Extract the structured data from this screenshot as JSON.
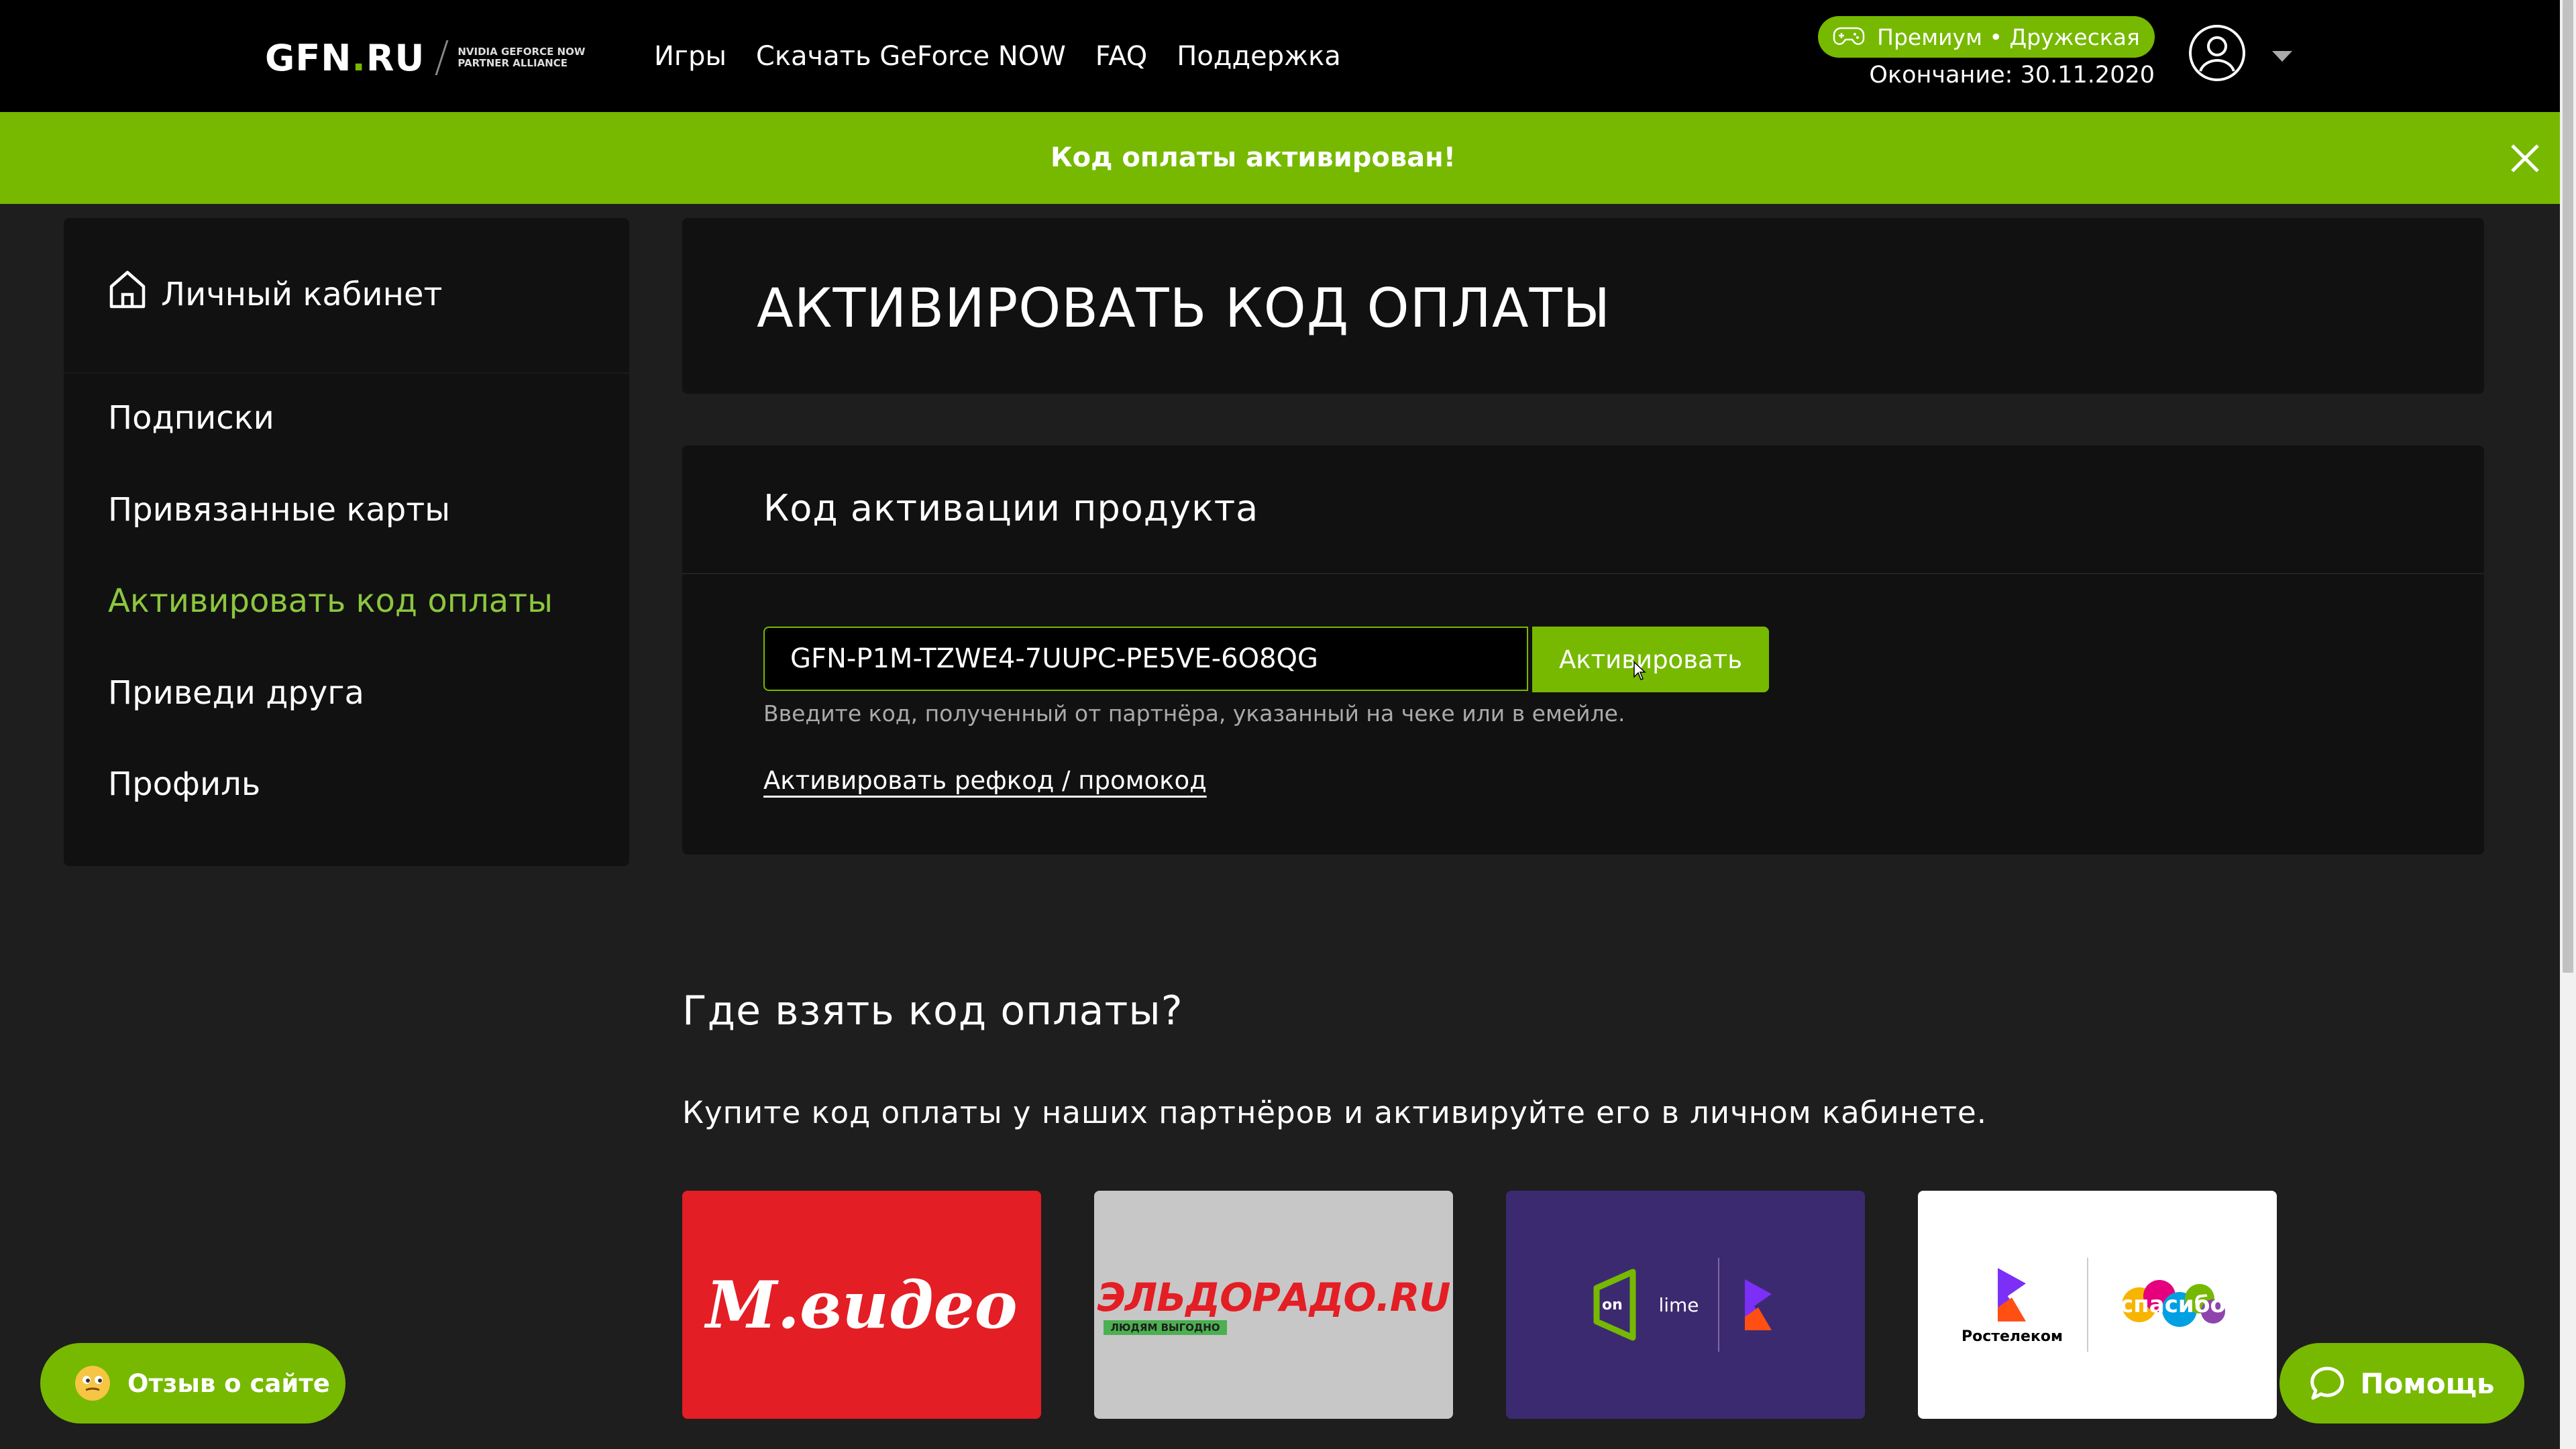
{
  "header": {
    "logo_main": "GFN",
    "logo_dot": ".",
    "logo_ru": "RU",
    "logo_sub_1": "NVIDIA GEFORCE NOW",
    "logo_sub_2": "PARTNER ALLIANCE",
    "nav": [
      {
        "label": "Игры"
      },
      {
        "label": "Скачать GeForce NOW"
      },
      {
        "label": "FAQ"
      },
      {
        "label": "Поддержка"
      }
    ],
    "plan_badge": "Премиум • Дружеская",
    "plan_end": "Окончание: 30.11.2020",
    "icons": {
      "plan": "gamepad-icon",
      "avatar": "user-avatar-icon",
      "menu": "chevron-down-icon"
    }
  },
  "notification": {
    "text": "Код оплаты активирован!",
    "close_icon": "close-icon"
  },
  "sidebar": {
    "title": "Личный кабинет",
    "icon": "home-icon",
    "items": [
      {
        "label": "Подписки",
        "active": false
      },
      {
        "label": "Привязанные карты",
        "active": false
      },
      {
        "label": "Активировать код оплаты",
        "active": true
      },
      {
        "label": "Приведи друга",
        "active": false
      },
      {
        "label": "Профиль",
        "active": false
      }
    ]
  },
  "main": {
    "page_title": "АКТИВИРОВАТЬ КОД ОПЛАТЫ",
    "activation": {
      "title": "Код активации продукта",
      "code_value": "GFN-P1M-TZWE4-7UUPC-PE5VE-6O8QG",
      "button_label": "Активировать",
      "hint": "Введите код, полученный от партнёра, указанный на чеке или в емейле.",
      "promo_link": "Активировать рефкод / промокод"
    },
    "where": {
      "title": "Где взять код оплаты?",
      "description": "Купите код оплаты у наших партнёров и активируйте его в личном кабинете.",
      "partners": [
        {
          "name": "М.видео",
          "logo_text": "М.видео"
        },
        {
          "name": "Эльдорадо",
          "logo_text": "ЭЛЬДОРАДО.RU",
          "logo_sub": "ЛЮДЯМ ВЫГОДНО"
        },
        {
          "name": "Onlime",
          "logo_text_on": "on",
          "logo_text_lime": "lime"
        },
        {
          "name": "Ростелеком",
          "logo_text": "Ростелеком",
          "logo_text_2": "спасибо"
        }
      ]
    }
  },
  "floating": {
    "feedback_label": "Отзыв о сайте",
    "help_label": "Помощь"
  },
  "colors": {
    "accent": "#76b900",
    "accent_text": "#8cc63f",
    "background": "#1e1e1e",
    "card": "#111111",
    "topbar": "#000000"
  }
}
